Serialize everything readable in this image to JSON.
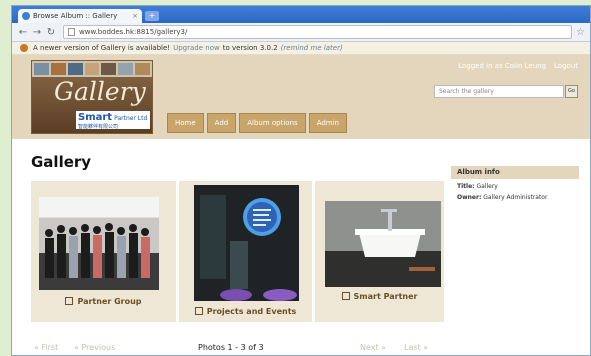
{
  "browser": {
    "tab_title": "Browse Album :: Gallery",
    "tab_close": "×",
    "new_tab": "+",
    "url": "www.boddes.hk:8815/gallery3/",
    "back": "←",
    "forward": "→",
    "reload": "↻",
    "star": "☆"
  },
  "notice": {
    "prefix": "A newer version of Gallery is available!",
    "link": "Upgrade now",
    "suffix": "to version 3.0.2",
    "dismiss": "(remind me later)"
  },
  "header": {
    "logo_word": "Gallery",
    "logo_smart": "Smart",
    "logo_partner": "Partner Ltd",
    "logo_cn": "智能夥伴有限公司",
    "logged_in_as": "Logged in as Colin Leung",
    "logout": "Logout",
    "search_placeholder": "Search the gallery",
    "go": "Go",
    "menu": [
      "Home",
      "Add",
      "Album options",
      "Admin"
    ]
  },
  "page": {
    "title": "Gallery",
    "items": [
      {
        "caption": "Partner Group"
      },
      {
        "caption": "Projects and Events"
      },
      {
        "caption": "Smart Partner"
      }
    ],
    "pager": {
      "first": "« First",
      "previous": "« Previous",
      "count": "Photos 1 - 3 of 3",
      "next": "Next »",
      "last": "Last »"
    }
  },
  "sidebar": {
    "heading": "Album info",
    "title_label": "Title:",
    "title_value": "Gallery",
    "owner_label": "Owner:",
    "owner_value": "Gallery Administrator"
  },
  "colors": {
    "header_bg": "#e3d6bd",
    "menu_bg": "#c8a56b",
    "caption_text": "#6b4f24",
    "page_bg": "#dfeed0"
  }
}
